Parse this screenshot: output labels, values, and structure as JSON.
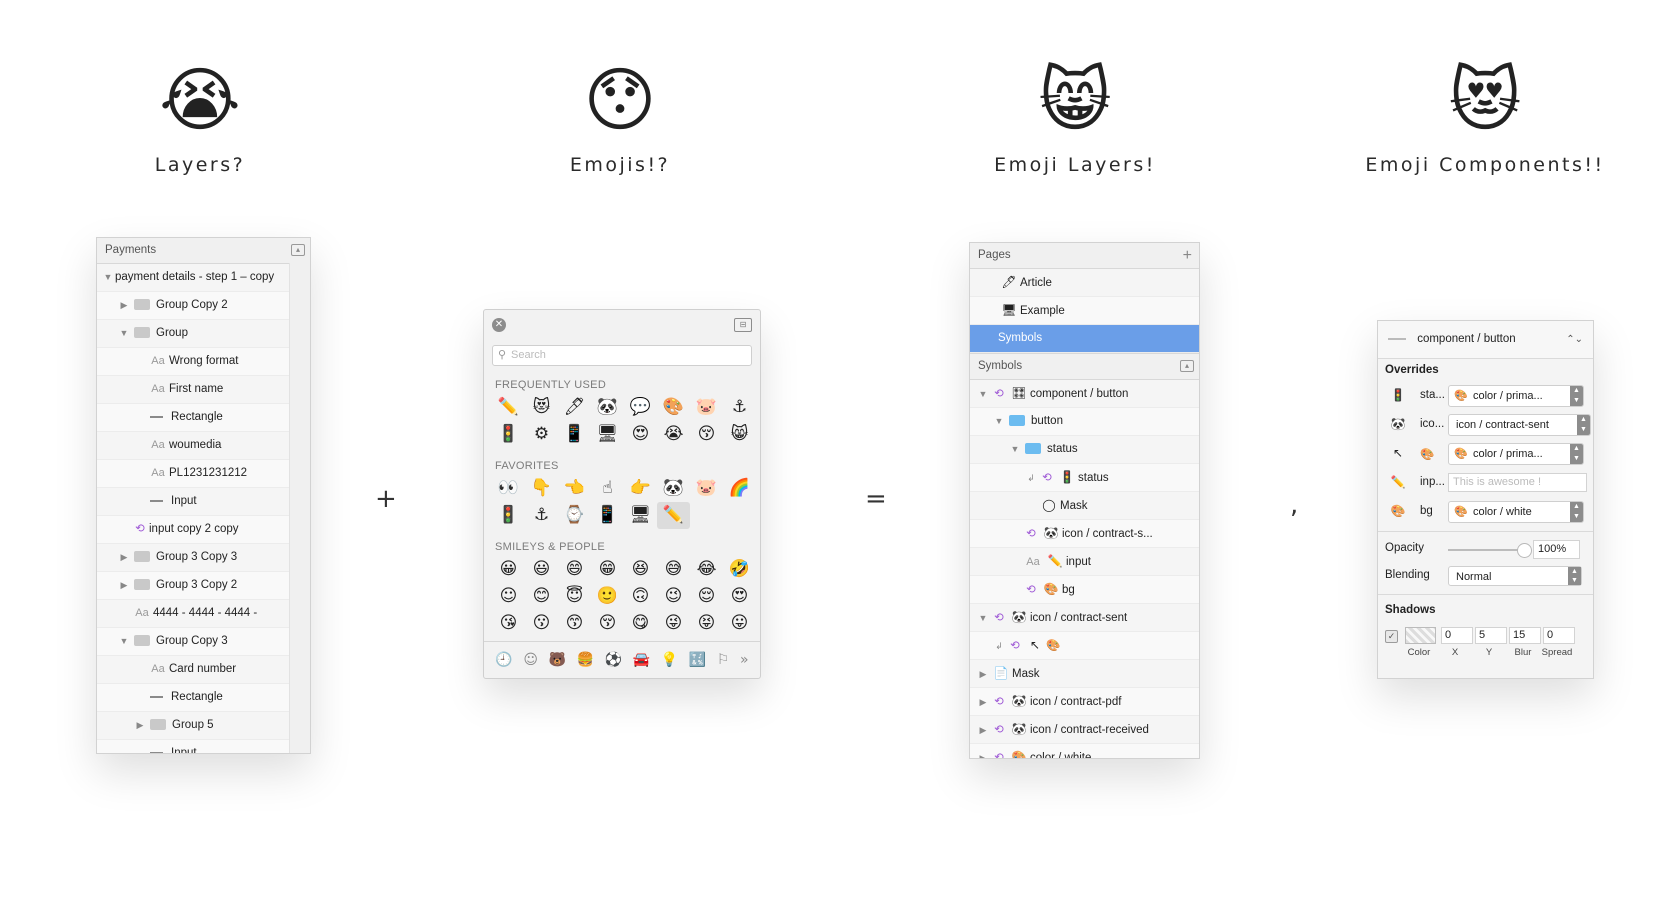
{
  "headlines": [
    {
      "emoji": "😭",
      "title": "Layers?"
    },
    {
      "emoji": "😯",
      "title": "Emojis!?"
    },
    {
      "emoji": "😸",
      "title": "Emoji Layers!"
    },
    {
      "emoji": "😻",
      "title": "Emoji Components!!"
    }
  ],
  "operators": {
    "plus": "+",
    "equals": "=",
    "comma": ","
  },
  "layers_panel": {
    "header": "Payments",
    "rows": [
      {
        "indent": 0,
        "tri": "▼",
        "kind": "none",
        "label": "payment details - step 1 – copy"
      },
      {
        "indent": 1,
        "tri": "▶",
        "kind": "folder",
        "label": "Group Copy 2"
      },
      {
        "indent": 1,
        "tri": "▼",
        "kind": "folder",
        "label": "Group"
      },
      {
        "indent": 2,
        "tri": "",
        "kind": "text",
        "label": "Wrong format"
      },
      {
        "indent": 2,
        "tri": "",
        "kind": "text",
        "label": "First name"
      },
      {
        "indent": 2,
        "tri": "",
        "kind": "shape",
        "label": "Rectangle"
      },
      {
        "indent": 2,
        "tri": "",
        "kind": "text",
        "label": "woumedia"
      },
      {
        "indent": 2,
        "tri": "",
        "kind": "text",
        "label": "PL1231231212"
      },
      {
        "indent": 2,
        "tri": "",
        "kind": "shape",
        "label": "Input"
      },
      {
        "indent": 1,
        "tri": "",
        "kind": "symbol",
        "label": "input copy 2 copy"
      },
      {
        "indent": 1,
        "tri": "▶",
        "kind": "folder",
        "label": "Group 3 Copy 3"
      },
      {
        "indent": 1,
        "tri": "▶",
        "kind": "folder",
        "label": "Group 3 Copy 2"
      },
      {
        "indent": 1,
        "tri": "",
        "kind": "text",
        "label": "4444 - 4444 - 4444 -"
      },
      {
        "indent": 1,
        "tri": "▼",
        "kind": "folder",
        "label": "Group Copy 3"
      },
      {
        "indent": 2,
        "tri": "",
        "kind": "text",
        "label": "Card number"
      },
      {
        "indent": 2,
        "tri": "",
        "kind": "shape",
        "label": "Rectangle"
      },
      {
        "indent": 2,
        "tri": "▶",
        "kind": "folder",
        "label": "Group 5"
      },
      {
        "indent": 2,
        "tri": "",
        "kind": "shape",
        "label": "Input"
      }
    ],
    "text_glyph": "Aa"
  },
  "emoji_picker": {
    "close_glyph": "✕",
    "search_placeholder": "Search",
    "sections": [
      {
        "label": "FREQUENTLY USED",
        "emojis": [
          "✏️",
          "😻",
          "🖊",
          "🐼",
          "💬",
          "🎨",
          "🐷",
          "⚓",
          "🚦",
          "⚙",
          "📱",
          "🖥",
          "😍",
          "😭",
          "😚",
          "😸"
        ]
      },
      {
        "label": "FAVORITES",
        "emojis": [
          "👀",
          "👇",
          "👈",
          "☝",
          "👉",
          "🐼",
          "🐷",
          "🌈",
          "🚦",
          "⚓",
          "⌚",
          "📱",
          "🖥",
          "✏️"
        ]
      },
      {
        "label": "SMILEYS & PEOPLE",
        "emojis": [
          "😀",
          "😃",
          "😄",
          "😁",
          "😆",
          "😅",
          "😂",
          "🤣",
          "☺",
          "😊",
          "😇",
          "🙂",
          "🙃",
          "😉",
          "😌",
          "😍",
          "😘",
          "😗",
          "😙",
          "😚",
          "😋",
          "😜",
          "😝",
          "😛"
        ]
      }
    ],
    "selected_favorite_index": 13,
    "categories": [
      "🕘",
      "☺",
      "🐻",
      "🍔",
      "⚽",
      "🚘",
      "💡",
      "🔣",
      "⚐",
      "»"
    ]
  },
  "symbols_panel": {
    "pages_header": "Pages",
    "add_glyph": "+",
    "pages": [
      {
        "emoji": "🖊",
        "label": "Article"
      },
      {
        "emoji": "🖥",
        "label": "Example"
      },
      {
        "emoji": "",
        "label": "Symbols"
      }
    ],
    "symbols_header": "Symbols",
    "rows": [
      {
        "indent": 0,
        "tri": "▼",
        "sym": true,
        "emoji": "🎛",
        "folder": false,
        "label": "component / button"
      },
      {
        "indent": 1,
        "tri": "▼",
        "sym": false,
        "emoji": "",
        "folder": true,
        "label": "button"
      },
      {
        "indent": 2,
        "tri": "▼",
        "sym": false,
        "emoji": "",
        "folder": true,
        "label": "status"
      },
      {
        "indent": 3,
        "tri": "↲",
        "sym": true,
        "emoji": "🚦",
        "folder": false,
        "label": "status"
      },
      {
        "indent": 3,
        "tri": "",
        "sym": false,
        "emoji": "◯",
        "folder": false,
        "label": "Mask"
      },
      {
        "indent": 2,
        "tri": "",
        "sym": true,
        "emoji": "🐼",
        "folder": false,
        "label": "icon / contract-s..."
      },
      {
        "indent": 2,
        "tri": "",
        "sym": false,
        "emoji": "✏️",
        "folder": false,
        "label": "input",
        "text": true
      },
      {
        "indent": 2,
        "tri": "",
        "sym": true,
        "emoji": "🎨",
        "folder": false,
        "label": "bg"
      },
      {
        "indent": 0,
        "tri": "▼",
        "sym": true,
        "emoji": "🐼",
        "folder": false,
        "label": "icon / contract-sent"
      },
      {
        "indent": 1,
        "tri": "↲",
        "sym": true,
        "emoji": "↖",
        "folder": false,
        "label": "🎨"
      },
      {
        "indent": 0,
        "tri": "▶",
        "sym": false,
        "emoji": "📄",
        "folder": false,
        "label": "Mask"
      },
      {
        "indent": 0,
        "tri": "▶",
        "sym": true,
        "emoji": "🐼",
        "folder": false,
        "label": "icon / contract-pdf"
      },
      {
        "indent": 0,
        "tri": "▶",
        "sym": true,
        "emoji": "🐼",
        "folder": false,
        "label": "icon / contract-received"
      },
      {
        "indent": 0,
        "tri": "▶",
        "sym": true,
        "emoji": "🎨",
        "folder": false,
        "label": "color / white"
      }
    ]
  },
  "overrides_panel": {
    "component": "component / button",
    "chevron": "⌃⌄",
    "overrides_label": "Overrides",
    "overrides": [
      {
        "emoji": "🚦",
        "name": "sta...",
        "value_emoji": "🎨",
        "value": "color / prima...",
        "type": "select"
      },
      {
        "emoji": "🐼",
        "name": "ico...",
        "value_emoji": "",
        "value": "icon / contract-sent",
        "type": "select"
      },
      {
        "emoji": "↖",
        "name": "🎨",
        "value_emoji": "🎨",
        "value": "color / prima...",
        "type": "select"
      },
      {
        "emoji": "✏️",
        "name": "inp...",
        "value_emoji": "",
        "value": "This is awesome !",
        "type": "input"
      },
      {
        "emoji": "🎨",
        "name": "bg",
        "value_emoji": "🎨",
        "value": "color / white",
        "type": "select"
      }
    ],
    "opacity_label": "Opacity",
    "opacity_value": "100%",
    "opacity_level": 1.0,
    "blending_label": "Blending",
    "blending_value": "Normal",
    "shadows_label": "Shadows",
    "shadow": {
      "checked_glyph": "✓",
      "x": "0",
      "y": "5",
      "blur": "15",
      "spread": "0",
      "color_cap": "Color",
      "x_cap": "X",
      "y_cap": "Y",
      "blur_cap": "Blur",
      "spread_cap": "Spread"
    }
  }
}
